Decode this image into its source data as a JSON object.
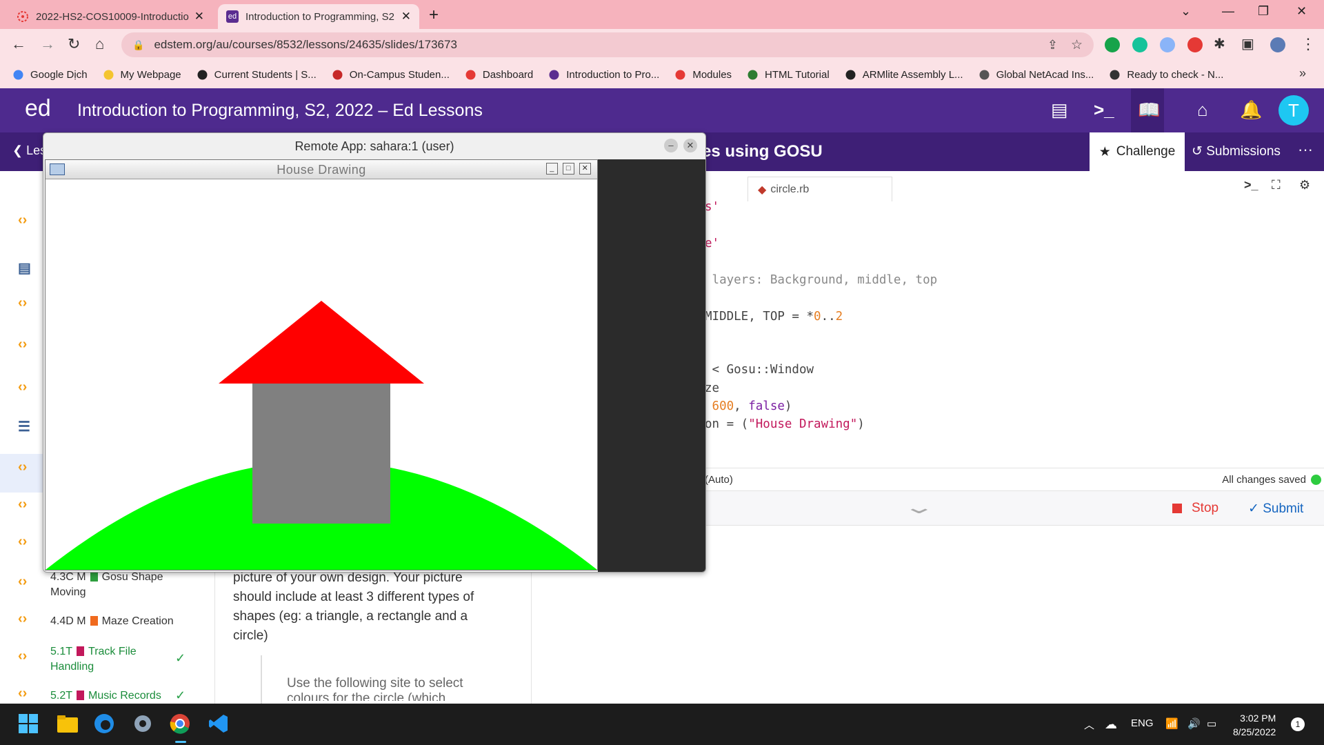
{
  "browser": {
    "tabs": [
      {
        "title": "2022-HS2-COS10009-Introductio"
      },
      {
        "title": "Introduction to Programming, S2"
      }
    ],
    "url": "edstem.org/au/courses/8532/lessons/24635/slides/173673",
    "bookmarks": [
      {
        "label": "Google Dịch",
        "icon": "google-translate-icon",
        "color": "#4285f4"
      },
      {
        "label": "My Webpage",
        "icon": "folder-icon",
        "color": "#f4c430"
      },
      {
        "label": "Current Students | S...",
        "icon": "globe-icon",
        "color": "#222222"
      },
      {
        "label": "On-Campus Studen...",
        "icon": "flag-icon",
        "color": "#c62828"
      },
      {
        "label": "Dashboard",
        "icon": "canvas-icon",
        "color": "#e53935"
      },
      {
        "label": "Introduction to Pro...",
        "icon": "ed-icon",
        "color": "#5b2d90"
      },
      {
        "label": "Modules",
        "icon": "canvas-icon",
        "color": "#e53935"
      },
      {
        "label": "HTML Tutorial",
        "icon": "w3-icon",
        "color": "#2e7d32"
      },
      {
        "label": "ARMlite Assembly L...",
        "icon": "globe-icon",
        "color": "#222222"
      },
      {
        "label": "Global NetAcad Ins...",
        "icon": "cisco-icon",
        "color": "#555555"
      },
      {
        "label": "Ready to check - N...",
        "icon": "bird-icon",
        "color": "#333333"
      }
    ],
    "bookmarks_overflow": "»"
  },
  "ed": {
    "logo": "ed",
    "title": "Introduction to Programming, S2, 2022 – Ed Lessons",
    "avatar_letter": "T",
    "back_label": "Les",
    "slide_title_fragment": "es using GOSU",
    "challenge_label": "Challenge",
    "submissions_label": "Submissions",
    "more_label": "···"
  },
  "lessons": [
    {
      "code": "4.3C M",
      "name": "Gosu Shape",
      "name2": "Moving",
      "color": "#2e9e3e",
      "done": false
    },
    {
      "code": "4.4D M",
      "name": "Maze Creation",
      "name2": "",
      "color": "#f06a1e",
      "done": false
    },
    {
      "code": "5.1T",
      "name": "Track File",
      "name2": "Handling",
      "color": "#c2185b",
      "done": true
    },
    {
      "code": "5.2T",
      "name": "Music Records",
      "name2": "",
      "color": "#c2185b",
      "done": true
    }
  ],
  "content": {
    "paragraph_lines": [
      "picture of your own design.  Your picture",
      "should include at least 3 different types of",
      "shapes (eg: a triangle, a rectangle and a",
      "circle)"
    ],
    "quote_text": "Use the following site to select",
    "quote_text2": "colours for the circle (which"
  },
  "editor": {
    "file_tab": "circle.rb",
    "code_lines": [
      {
        "parts": [
          {
            "t": "s'",
            "c": "str"
          }
        ]
      },
      {
        "parts": [
          {
            "t": "e'",
            "c": "str"
          }
        ]
      },
      {
        "parts": [
          {
            "t": " layers: Background, middle, top",
            "c": "gray"
          }
        ]
      },
      {
        "parts": [
          {
            "t": "MIDDLE, TOP = *",
            "c": ""
          },
          {
            "t": "0",
            "c": "num"
          },
          {
            "t": "..",
            "c": ""
          },
          {
            "t": "2",
            "c": "num"
          }
        ]
      },
      {
        "parts": [
          {
            "t": " < Gosu::Window",
            "c": ""
          }
        ]
      },
      {
        "parts": [
          {
            "t": "ze",
            "c": ""
          }
        ]
      },
      {
        "parts": [
          {
            "t": " ",
            "c": ""
          },
          {
            "t": "600",
            "c": "num"
          },
          {
            "t": ", ",
            "c": ""
          },
          {
            "t": "false",
            "c": "kw"
          },
          {
            "t": ")",
            "c": ""
          }
        ]
      },
      {
        "parts": [
          {
            "t": "on = (",
            "c": ""
          },
          {
            "t": "\"House Drawing\"",
            "c": "str"
          },
          {
            "t": ")",
            "c": ""
          }
        ]
      }
    ],
    "mode": "(Auto)",
    "saved_status": "All changes saved",
    "stop_label": "Stop",
    "submit_label": "Submit"
  },
  "remote_app": {
    "title": "Remote App: sahara:1 (user)",
    "window_title": "House Drawing",
    "colors": {
      "sky": "#ffffff",
      "hill": "#00ff00",
      "house": "#808080",
      "roof": "#ff0000"
    }
  },
  "taskbar": {
    "language": "ENG",
    "time": "3:02 PM",
    "date": "8/25/2022",
    "notifications": "1"
  }
}
